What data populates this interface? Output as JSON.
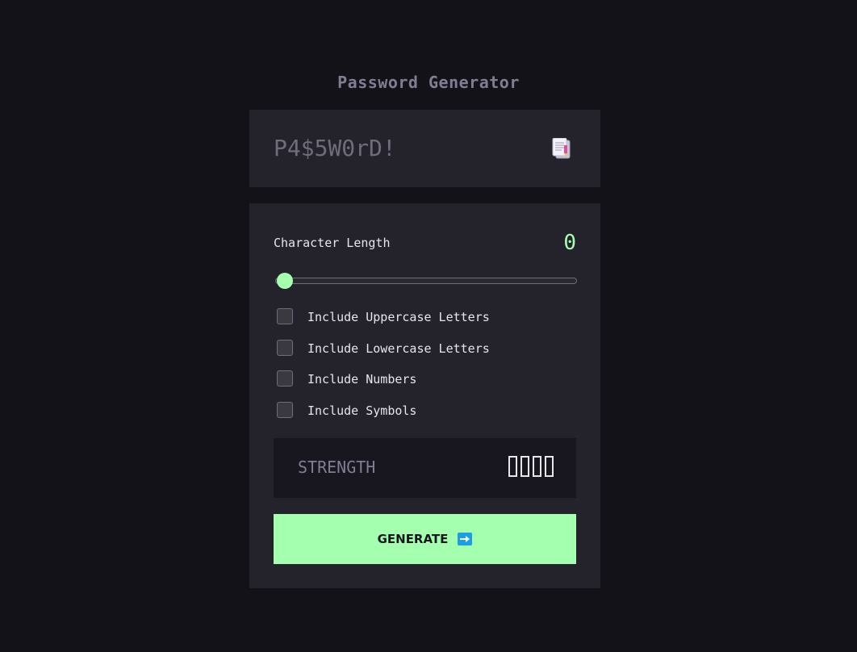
{
  "title": "Password Generator",
  "password": {
    "value": "P4$5W0rD!",
    "copy_icon": "copy-icon"
  },
  "length": {
    "label": "Character Length",
    "value": "0",
    "slider_value": 0
  },
  "options": [
    {
      "label": "Include Uppercase Letters",
      "checked": false
    },
    {
      "label": "Include Lowercase Letters",
      "checked": false
    },
    {
      "label": "Include Numbers",
      "checked": false
    },
    {
      "label": "Include Symbols",
      "checked": false
    }
  ],
  "strength": {
    "label": "STRENGTH",
    "filled_bars": 0,
    "total_bars": 4
  },
  "generate": {
    "label": "GENERATE",
    "icon": "arrow-right-icon"
  },
  "colors": {
    "background": "#131218",
    "panel": "#24232c",
    "accent": "#a4ffaf",
    "muted": "#817d92"
  }
}
